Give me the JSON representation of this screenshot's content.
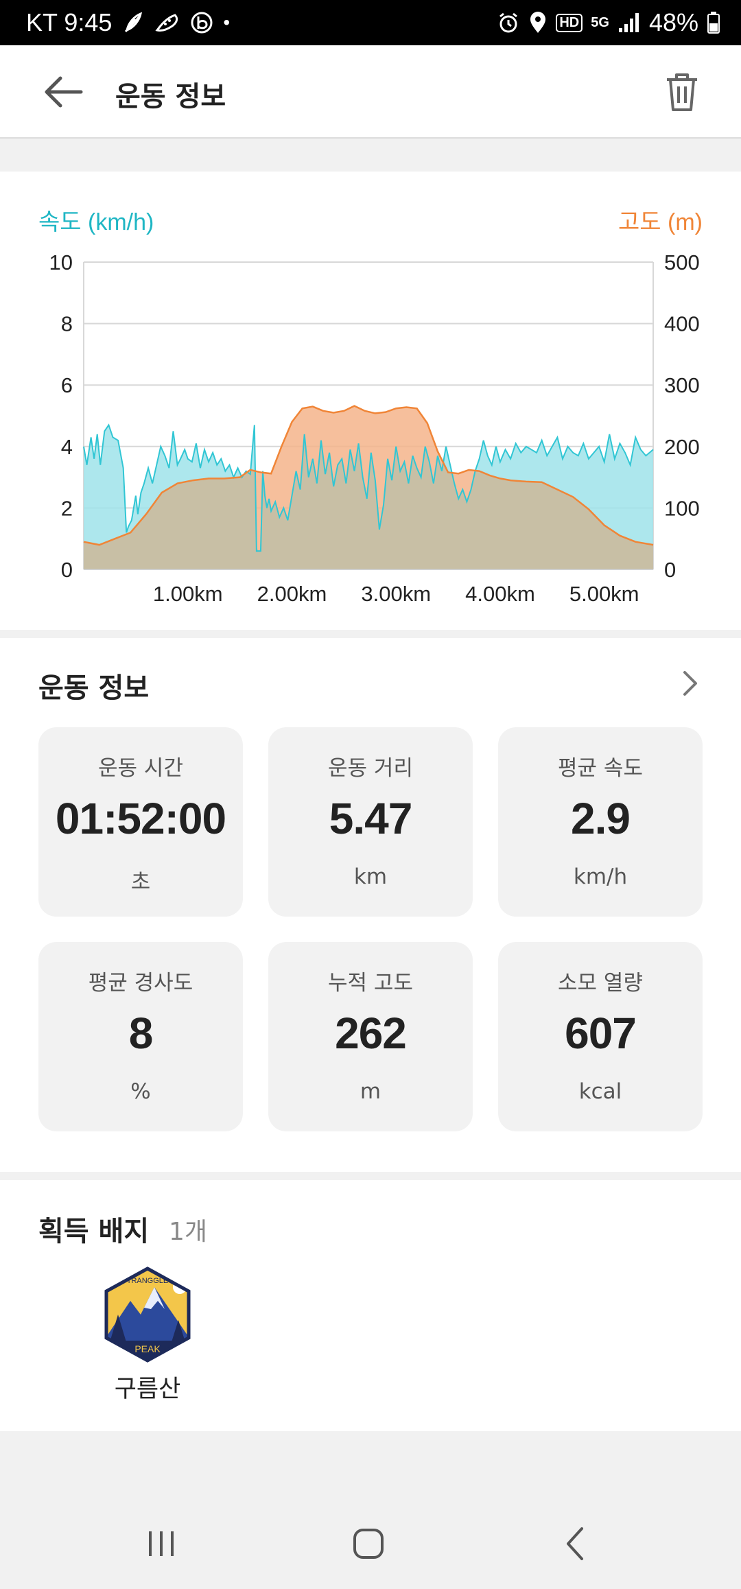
{
  "status_bar": {
    "carrier_time": "KT 9:45",
    "dot": "•",
    "hd": "HD",
    "network": "5G",
    "battery": "48%"
  },
  "header": {
    "title": "운동 정보"
  },
  "chart": {
    "left_axis_title": "속도 (km/h)",
    "right_axis_title": "고도 (m)",
    "speed_color": "#9fe3ea",
    "speed_line_color": "#31c6d4",
    "altitude_color": "#f5b48b",
    "altitude_line_color": "#f08537",
    "overlap_color": "#c8bfa5"
  },
  "chart_data": {
    "type": "area",
    "x_tick_labels": [
      "1.00km",
      "2.00km",
      "3.00km",
      "4.00km",
      "5.00km"
    ],
    "x_ticks": [
      1,
      2,
      3,
      4,
      5
    ],
    "xlim": [
      0,
      5.47
    ],
    "left_ylim": [
      0,
      10
    ],
    "left_ticks": [
      0,
      2,
      4,
      6,
      8,
      10
    ],
    "right_ylim": [
      0,
      500
    ],
    "right_ticks": [
      0,
      100,
      200,
      300,
      400,
      500
    ],
    "grid": true,
    "series": [
      {
        "name": "속도 (km/h)",
        "axis": "left",
        "x": [
          0,
          0.03,
          0.07,
          0.1,
          0.13,
          0.16,
          0.2,
          0.24,
          0.28,
          0.33,
          0.38,
          0.41,
          0.43,
          0.46,
          0.5,
          0.52,
          0.55,
          0.58,
          0.62,
          0.66,
          0.7,
          0.74,
          0.78,
          0.82,
          0.86,
          0.9,
          0.93,
          0.97,
          1.0,
          1.04,
          1.08,
          1.12,
          1.16,
          1.2,
          1.24,
          1.28,
          1.32,
          1.36,
          1.4,
          1.44,
          1.48,
          1.52,
          1.56,
          1.6,
          1.64,
          1.66,
          1.68,
          1.7,
          1.72,
          1.74,
          1.76,
          1.78,
          1.8,
          1.84,
          1.88,
          1.92,
          1.96,
          2.0,
          2.04,
          2.08,
          2.12,
          2.16,
          2.2,
          2.24,
          2.28,
          2.32,
          2.36,
          2.4,
          2.44,
          2.48,
          2.52,
          2.56,
          2.6,
          2.64,
          2.68,
          2.72,
          2.76,
          2.8,
          2.84,
          2.88,
          2.92,
          2.96,
          3.0,
          3.04,
          3.08,
          3.12,
          3.16,
          3.2,
          3.24,
          3.28,
          3.32,
          3.36,
          3.4,
          3.44,
          3.48,
          3.52,
          3.56,
          3.6,
          3.64,
          3.68,
          3.72,
          3.76,
          3.8,
          3.84,
          3.88,
          3.92,
          3.96,
          4.0,
          4.05,
          4.1,
          4.15,
          4.2,
          4.25,
          4.3,
          4.35,
          4.4,
          4.45,
          4.5,
          4.55,
          4.6,
          4.65,
          4.7,
          4.75,
          4.8,
          4.85,
          4.9,
          4.95,
          5.0,
          5.05,
          5.1,
          5.15,
          5.2,
          5.25,
          5.3,
          5.35,
          5.4,
          5.47
        ],
        "values": [
          4.0,
          3.4,
          4.3,
          3.6,
          4.4,
          3.4,
          4.5,
          4.7,
          4.3,
          4.2,
          3.3,
          1.2,
          1.4,
          1.6,
          2.4,
          1.8,
          2.5,
          2.8,
          3.3,
          2.8,
          3.4,
          4.0,
          3.7,
          3.3,
          4.5,
          3.4,
          3.6,
          3.9,
          3.6,
          3.5,
          4.1,
          3.3,
          3.9,
          3.5,
          3.8,
          3.4,
          3.6,
          3.2,
          3.4,
          3.0,
          3.3,
          3.0,
          3.2,
          3.1,
          4.7,
          0.6,
          0.6,
          0.6,
          3.2,
          2.4,
          2.0,
          2.3,
          1.9,
          2.2,
          1.7,
          2.0,
          1.6,
          2.4,
          3.2,
          2.6,
          4.4,
          3.0,
          3.6,
          2.8,
          4.2,
          3.1,
          3.8,
          2.7,
          3.4,
          3.6,
          2.8,
          3.9,
          3.2,
          4.1,
          3.0,
          2.3,
          3.8,
          2.9,
          1.3,
          2.1,
          3.6,
          2.9,
          4.0,
          3.2,
          3.5,
          2.8,
          3.7,
          3.3,
          3.0,
          4.0,
          3.5,
          2.8,
          3.7,
          3.2,
          4.0,
          3.4,
          2.8,
          2.3,
          2.6,
          2.2,
          2.6,
          3.2,
          3.6,
          4.2,
          3.7,
          3.4,
          4.0,
          3.5,
          3.9,
          3.6,
          4.1,
          3.8,
          4.0,
          3.9,
          3.8,
          4.2,
          3.7,
          4.0,
          4.3,
          3.6,
          4.0,
          3.8,
          3.7,
          4.1,
          3.6,
          3.8,
          4.0,
          3.5,
          4.4,
          3.6,
          4.1,
          3.8,
          3.4,
          4.3,
          3.9,
          3.7,
          3.9
        ]
      },
      {
        "name": "고도 (m)",
        "axis": "right",
        "x": [
          0,
          0.15,
          0.3,
          0.45,
          0.6,
          0.75,
          0.9,
          1.05,
          1.2,
          1.35,
          1.5,
          1.6,
          1.7,
          1.8,
          1.9,
          2.0,
          2.1,
          2.2,
          2.3,
          2.4,
          2.5,
          2.6,
          2.7,
          2.8,
          2.9,
          3.0,
          3.1,
          3.2,
          3.3,
          3.4,
          3.5,
          3.6,
          3.7,
          3.8,
          3.9,
          4.0,
          4.1,
          4.25,
          4.4,
          4.55,
          4.7,
          4.85,
          5.0,
          5.15,
          5.3,
          5.47
        ],
        "values": [
          45,
          40,
          50,
          60,
          90,
          125,
          140,
          145,
          148,
          148,
          150,
          162,
          158,
          156,
          200,
          240,
          262,
          265,
          258,
          255,
          258,
          266,
          258,
          254,
          256,
          262,
          264,
          262,
          238,
          192,
          158,
          156,
          162,
          160,
          153,
          148,
          145,
          143,
          142,
          130,
          118,
          98,
          72,
          55,
          45,
          40
        ]
      }
    ]
  },
  "stats": {
    "section_title": "운동 정보",
    "tiles": [
      {
        "label": "운동 시간",
        "value": "01:52:00",
        "unit": "초"
      },
      {
        "label": "운동 거리",
        "value": "5.47",
        "unit": "km"
      },
      {
        "label": "평균 속도",
        "value": "2.9",
        "unit": "km/h"
      },
      {
        "label": "평균 경사도",
        "value": "8",
        "unit": "%"
      },
      {
        "label": "누적 고도",
        "value": "262",
        "unit": "m"
      },
      {
        "label": "소모 열량",
        "value": "607",
        "unit": "kcal"
      }
    ]
  },
  "badges": {
    "title": "획득 배지",
    "count": "1개",
    "items": [
      {
        "name": "구름산",
        "top_text": "TRANGGLE",
        "bottom_text": "PEAK"
      }
    ]
  }
}
